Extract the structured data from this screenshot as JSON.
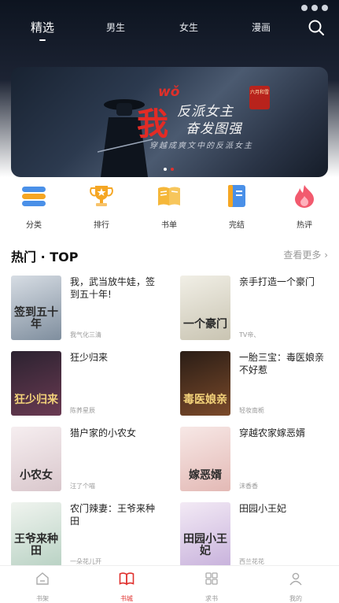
{
  "top_nav": {
    "tabs": [
      {
        "label": "精选",
        "active": true
      },
      {
        "label": "男生",
        "active": false
      },
      {
        "label": "女生",
        "active": false
      },
      {
        "label": "漫画",
        "active": false
      }
    ],
    "search_icon": "search-icon"
  },
  "banner": {
    "pinyin": "wǒ",
    "big_char": "我",
    "title_line1": "反派女主",
    "title_line2": "奋发图强",
    "subtitle": "穿越成爽文中的反派女主",
    "seal_text": "六月和雪",
    "page_count": 2,
    "active_page": 2
  },
  "categories": [
    {
      "label": "分类",
      "icon": "category-icon"
    },
    {
      "label": "排行",
      "icon": "trophy-icon"
    },
    {
      "label": "书单",
      "icon": "book-list-icon"
    },
    {
      "label": "完结",
      "icon": "finished-book-icon"
    },
    {
      "label": "热评",
      "icon": "flame-icon"
    }
  ],
  "section": {
    "title": "热门 · TOP",
    "more": "查看更多 ›"
  },
  "books": [
    {
      "title": "我，武当放牛娃，签到五十年!",
      "author": "我气化三清",
      "cover_text": "签到五十年",
      "cover_colors": [
        "#d7dde4",
        "#7f8e9e"
      ]
    },
    {
      "title": "亲手打造一个豪门",
      "author": "TV帝、",
      "cover_text": "一个豪门",
      "cover_colors": [
        "#f1efe6",
        "#c9c4b2"
      ]
    },
    {
      "title": "狂少归来",
      "author": "陈荞星辰",
      "cover_text": "狂少归来",
      "cover_colors": [
        "#2b2230",
        "#6a3a52"
      ]
    },
    {
      "title": "一胎三宝：毒医娘亲不好惹",
      "author": "轻妆南栀",
      "cover_text": "毒医娘亲",
      "cover_colors": [
        "#2a1d16",
        "#7b4a2a"
      ]
    },
    {
      "title": "猎户家的小农女",
      "author": "汪了个喵",
      "cover_text": "小农女",
      "cover_colors": [
        "#f6eef0",
        "#d9c7cc"
      ]
    },
    {
      "title": "穿越农家嫁恶婿",
      "author": "沫香香",
      "cover_text": "嫁恶婿",
      "cover_colors": [
        "#f7e8e6",
        "#e3b9b5"
      ]
    },
    {
      "title": "农门辣妻：王爷来种田",
      "author": "一朵花儿开",
      "cover_text": "王爷来种田",
      "cover_colors": [
        "#f0f4ef",
        "#b9d2c4"
      ]
    },
    {
      "title": "田园小王妃",
      "author": "西兰花花",
      "cover_text": "田园小王妃",
      "cover_colors": [
        "#f3eaf5",
        "#c8b2dc"
      ]
    }
  ],
  "tabbar": [
    {
      "label": "书架",
      "icon": "bookshelf-icon",
      "active": false
    },
    {
      "label": "书城",
      "icon": "bookstore-icon",
      "active": true
    },
    {
      "label": "求书",
      "icon": "grid-icon",
      "active": false
    },
    {
      "label": "我的",
      "icon": "profile-icon",
      "active": false
    }
  ],
  "colors": {
    "accent": "#e0322f",
    "tab_active": "#e0322f",
    "tab_inactive": "#999999"
  }
}
